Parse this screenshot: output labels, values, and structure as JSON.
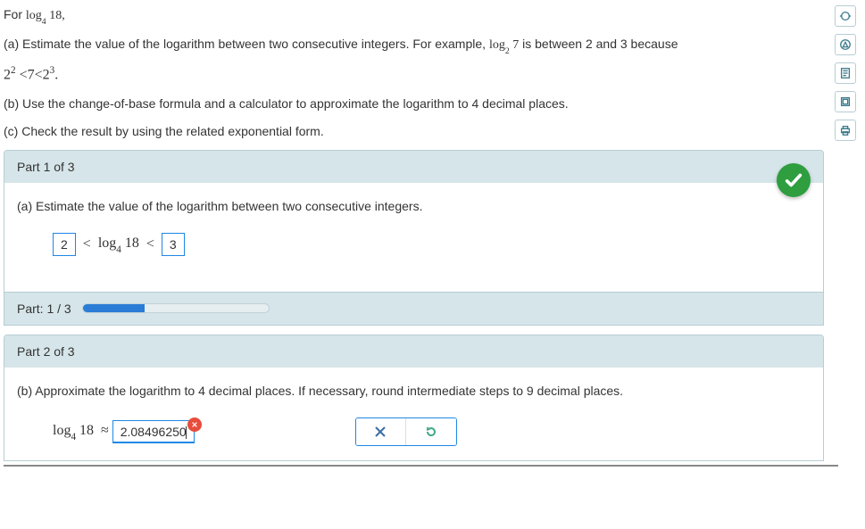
{
  "intro": {
    "prefix": "For ",
    "log_label": "log",
    "log_base": "4",
    "log_arg": "18,"
  },
  "prompt_a": "(a) Estimate the value of the logarithm between two consecutive integers. For example, ",
  "example": {
    "log_label": "log",
    "log_base": "2",
    "log_arg": "7",
    "between_text": " is between 2 and 3 because"
  },
  "inequality": {
    "left_base": "2",
    "left_exp": "2",
    "lt1": "<",
    "mid": "7",
    "lt2": "<",
    "right_base": "2",
    "right_exp": "3",
    "period": "."
  },
  "prompt_b": "(b) Use the change-of-base formula and a calculator to approximate the logarithm to 4 decimal places.",
  "prompt_c": "(c) Check the result by using the related exponential form.",
  "part1": {
    "header": "Part 1 of 3",
    "prompt": "(a) Estimate the value of the logarithm between two consecutive integers.",
    "lower": "2",
    "lt1": "<",
    "log_label": "log",
    "log_base": "4",
    "log_arg": "18",
    "lt2": "<",
    "upper": "3"
  },
  "progress": {
    "label": "Part: 1 / 3"
  },
  "part2": {
    "header": "Part 2 of 3",
    "prompt": "(b) Approximate the logarithm to 4 decimal places. If necessary, round intermediate steps to 9 decimal places.",
    "log_label": "log",
    "log_base": "4",
    "log_arg": "18",
    "approx": "≈",
    "value": "2.08496250"
  }
}
